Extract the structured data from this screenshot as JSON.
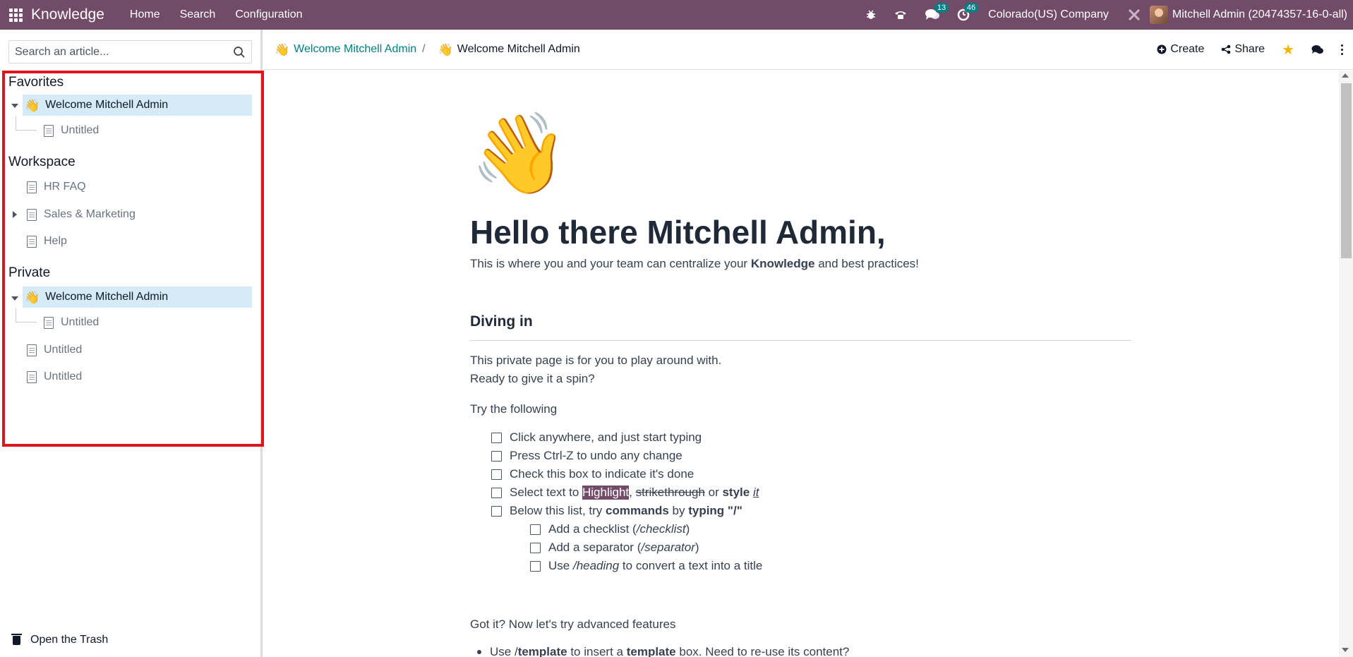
{
  "navbar": {
    "app_name": "Knowledge",
    "menu": [
      "Home",
      "Search",
      "Configuration"
    ],
    "messages_count": "13",
    "activities_count": "46",
    "company": "Colorado(US) Company",
    "user": "Mitchell Admin (20474357-16-0-all)"
  },
  "sidebar": {
    "search_placeholder": "Search an article...",
    "favorites_title": "Favorites",
    "favorites": {
      "parent": "Welcome Mitchell Admin",
      "child": "Untitled"
    },
    "workspace_title": "Workspace",
    "workspace": [
      "HR FAQ",
      "Sales & Marketing",
      "Help"
    ],
    "private_title": "Private",
    "private": {
      "parent": "Welcome Mitchell Admin",
      "child": "Untitled",
      "items": [
        "Untitled",
        "Untitled"
      ]
    },
    "trash_label": "Open the Trash"
  },
  "header": {
    "breadcrumb_parent": "Welcome Mitchell Admin",
    "breadcrumb_current": "Welcome Mitchell Admin",
    "create_label": "Create",
    "share_label": "Share"
  },
  "article": {
    "emoji": "👋",
    "title": "Hello there Mitchell Admin,",
    "intro_before": "This is where you and your team can centralize your ",
    "intro_bold": "Knowledge",
    "intro_after": " and best practices!",
    "section_title": "Diving in",
    "para1": "This private page is for you to play around with.",
    "para2": "Ready to give it a spin?",
    "para3": "Try the following",
    "checklist": [
      "Click anywhere, and just start typing",
      "Press Ctrl-Z to undo any change",
      "Check this box to indicate it's done"
    ],
    "select_text": {
      "prefix": "Select text to ",
      "highlight": "Highlight",
      "comma": ", ",
      "strike": "strikethrough",
      "or": " or ",
      "style": "style",
      "space": " ",
      "it": "it"
    },
    "commands_item": {
      "prefix": "Below this list, try ",
      "commands": "commands",
      "by": " by ",
      "typing": "typing",
      "slash": " \"/\""
    },
    "subchecklist": [
      {
        "before": "Add a checklist (",
        "em": "/checklist",
        "after": ")"
      },
      {
        "before": "Add a separator (",
        "em": "/separator",
        "after": ")"
      },
      {
        "before": "Use ",
        "em": "/heading",
        "after": " to convert a text into a title"
      }
    ],
    "advanced": "Got it? Now let's try advanced features",
    "bullet": {
      "prefix": "Use /",
      "template": "template",
      "mid": " to insert a ",
      "template2": "template",
      "suffix": " box. Need to re-use its content?"
    }
  }
}
